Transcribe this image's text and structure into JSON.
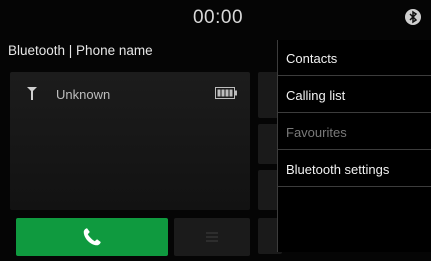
{
  "status_bar": {
    "time": "00:00",
    "icon": "bluetooth-icon"
  },
  "header": {
    "title": "Bluetooth | Phone name"
  },
  "phone_panel": {
    "carrier": "Unknown",
    "signal_icon": "signal-antenna-icon",
    "battery_icon": "battery-icon"
  },
  "buttons": {
    "call_icon": "phone-handset-icon",
    "menu_icon": "menu-lines-icon"
  },
  "options_menu": {
    "items": [
      {
        "label": "Contacts",
        "enabled": true
      },
      {
        "label": "Calling list",
        "enabled": true
      },
      {
        "label": "Favourites",
        "enabled": false
      },
      {
        "label": "Bluetooth settings",
        "enabled": true
      }
    ]
  },
  "colors": {
    "background": "#050505",
    "call_green": "#0f9a3f",
    "menu_bg": "#000000",
    "text": "#f2f2f2",
    "disabled_text": "#7a7a7a"
  }
}
